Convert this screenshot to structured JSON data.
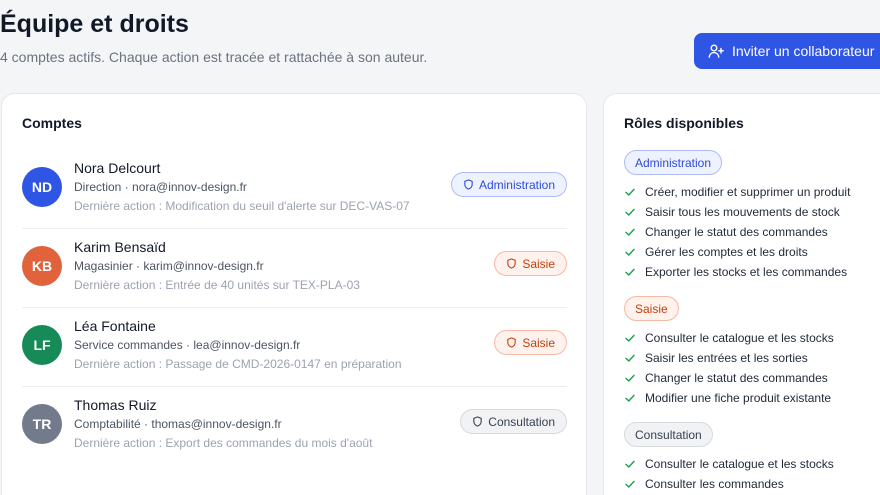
{
  "header": {
    "title": "Équipe et droits",
    "subtitle": "4 comptes actifs. Chaque action est tracée et rattachée à son auteur.",
    "invite_label": "Inviter un collaborateur"
  },
  "colors": {
    "accent": "#2f55e4",
    "admin": "#2f4bd3",
    "saisie": "#c2410c",
    "consultation": "#374151"
  },
  "accounts": {
    "title": "Comptes",
    "items": [
      {
        "initials": "ND",
        "name": "Nora Delcourt",
        "meta": "Direction · nora@innov-design.fr",
        "last_action": "Dernière action : Modification du seuil d'alerte sur DEC-VAS-07",
        "role": "Administration",
        "avatar_color": "#2f55e4"
      },
      {
        "initials": "KB",
        "name": "Karim Bensaïd",
        "meta": "Magasinier · karim@innov-design.fr",
        "last_action": "Dernière action : Entrée de 40 unités sur TEX-PLA-03",
        "role": "Saisie",
        "avatar_color": "#e0633b"
      },
      {
        "initials": "LF",
        "name": "Léa Fontaine",
        "meta": "Service commandes · lea@innov-design.fr",
        "last_action": "Dernière action : Passage de CMD-2026-0147 en préparation",
        "role": "Saisie",
        "avatar_color": "#168a57"
      },
      {
        "initials": "TR",
        "name": "Thomas Ruiz",
        "meta": "Comptabilité · thomas@innov-design.fr",
        "last_action": "Dernière action : Export des commandes du mois d'août",
        "role": "Consultation",
        "avatar_color": "#737a8c"
      }
    ]
  },
  "roles": {
    "title": "Rôles disponibles",
    "groups": [
      {
        "name": "Administration",
        "permissions": [
          "Créer, modifier et supprimer un produit",
          "Saisir tous les mouvements de stock",
          "Changer le statut des commandes",
          "Gérer les comptes et les droits",
          "Exporter les stocks et les commandes"
        ]
      },
      {
        "name": "Saisie",
        "permissions": [
          "Consulter le catalogue et les stocks",
          "Saisir les entrées et les sorties",
          "Changer le statut des commandes",
          "Modifier une fiche produit existante"
        ]
      },
      {
        "name": "Consultation",
        "permissions": [
          "Consulter le catalogue et les stocks",
          "Consulter les commandes"
        ]
      }
    ]
  }
}
